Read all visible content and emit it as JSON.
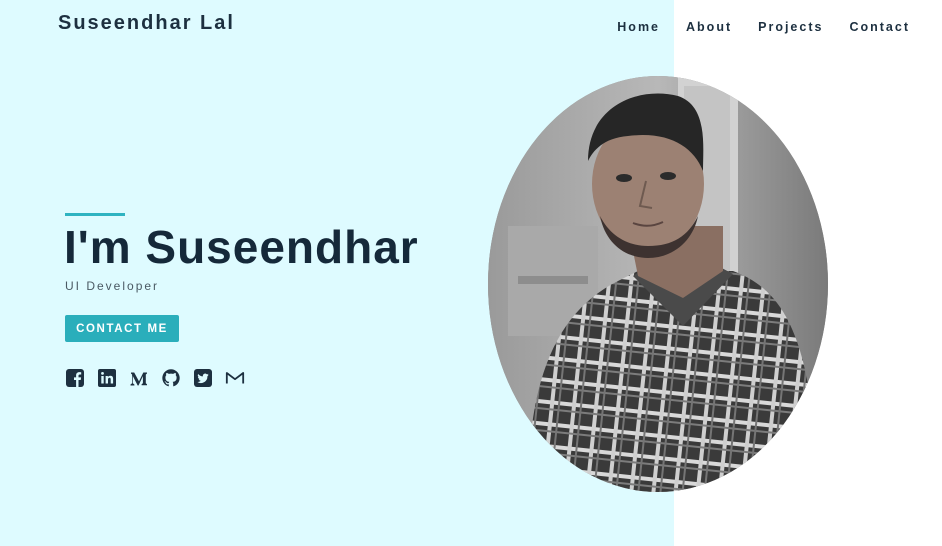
{
  "header": {
    "brand": "Suseendhar Lal",
    "nav": [
      "Home",
      "About",
      "Projects",
      "Contact"
    ]
  },
  "hero": {
    "headline": "I'm Suseendhar",
    "role": "UI Developer",
    "cta_label": "CONTACT ME",
    "socials": [
      "facebook-icon",
      "linkedin-icon",
      "medium-icon",
      "github-icon",
      "twitter-icon",
      "gmail-icon"
    ],
    "photo": "profile-photo"
  },
  "colors": {
    "hero_background": "#defbff",
    "accent": "#2aaebb",
    "text_dark": "#15293a"
  }
}
